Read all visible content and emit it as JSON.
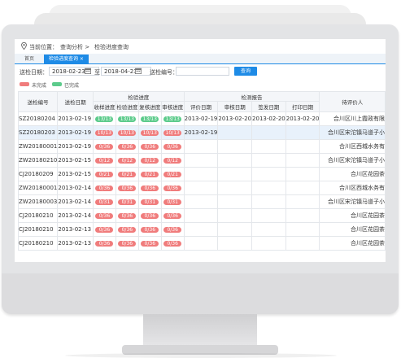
{
  "breadcrumb": {
    "location_label": "当前位置：",
    "path1": "查询分析 >",
    "path2": "检验进度查询"
  },
  "tabs": [
    {
      "label": "首页"
    },
    {
      "label": "检验进度查询 ×"
    }
  ],
  "filters": {
    "date_label": "送检日期：",
    "from_date": "2018-02-23",
    "to_label": "至",
    "to_date": "2018-04-23",
    "number_label": "送检编号：",
    "number_value": "",
    "query_button": "查询"
  },
  "legend": {
    "incomplete": {
      "label": "未完成",
      "color": "#f07c7c"
    },
    "complete": {
      "label": "已完成",
      "color": "#5ccb8b"
    }
  },
  "table": {
    "headers": {
      "code": "送检编号",
      "date": "送检日期",
      "progress_group": "检验进度",
      "report_group": "检测报告",
      "receive": "收样进度",
      "inspect": "检验进度",
      "recheck": "复核进度",
      "review": "审核进度",
      "eval_date": "评价日期",
      "audit_date": "审核日期",
      "sign_date": "签发日期",
      "print_date": "打印日期",
      "unit": "待评价人"
    },
    "rows": [
      {
        "code": "SZ20180204",
        "date": "2013-02-19",
        "p": [
          {
            "t": "13/13",
            "s": "green"
          },
          {
            "t": "13/13",
            "s": "green"
          },
          {
            "t": "13/13",
            "s": "green"
          },
          {
            "t": "13/13",
            "s": "green"
          }
        ],
        "eval": "2013-02-19",
        "audit": "2013-02-20",
        "sign": "2013-02-20",
        "print": "2013-02-20",
        "unit": "合川区川上霞政有限",
        "selected": false
      },
      {
        "code": "SZ20180203",
        "date": "2013-02-19",
        "p": [
          {
            "t": "10/13",
            "s": "red"
          },
          {
            "t": "10/13",
            "s": "red"
          },
          {
            "t": "10/13",
            "s": "red"
          },
          {
            "t": "10/13",
            "s": "red"
          }
        ],
        "eval": "2013-02-19",
        "audit": "",
        "sign": "",
        "print": "",
        "unit": "合川区宋沱镇马道子小",
        "selected": true
      },
      {
        "code": "ZW20180001",
        "date": "2013-02-19",
        "p": [
          {
            "t": "0/36",
            "s": "red"
          },
          {
            "t": "0/36",
            "s": "red"
          },
          {
            "t": "0/36",
            "s": "red"
          },
          {
            "t": "0/36",
            "s": "red"
          }
        ],
        "eval": "",
        "audit": "",
        "sign": "",
        "print": "",
        "unit": "合川区西城水务有",
        "selected": false
      },
      {
        "code": "ZW20180210",
        "date": "2013-02-15",
        "p": [
          {
            "t": "0/12",
            "s": "red"
          },
          {
            "t": "0/12",
            "s": "red"
          },
          {
            "t": "0/12",
            "s": "red"
          },
          {
            "t": "0/12",
            "s": "red"
          }
        ],
        "eval": "",
        "audit": "",
        "sign": "",
        "print": "",
        "unit": "合川区宋沱镇马道子小",
        "selected": false
      },
      {
        "code": "CJ20180209",
        "date": "2013-02-15",
        "p": [
          {
            "t": "0/21",
            "s": "red"
          },
          {
            "t": "0/21",
            "s": "red"
          },
          {
            "t": "0/21",
            "s": "red"
          },
          {
            "t": "0/21",
            "s": "red"
          }
        ],
        "eval": "",
        "audit": "",
        "sign": "",
        "print": "",
        "unit": "合川区花园茶",
        "selected": false
      },
      {
        "code": "ZW20180001",
        "date": "2013-02-14",
        "p": [
          {
            "t": "0/36",
            "s": "red"
          },
          {
            "t": "0/36",
            "s": "red"
          },
          {
            "t": "0/36",
            "s": "red"
          },
          {
            "t": "0/36",
            "s": "red"
          }
        ],
        "eval": "",
        "audit": "",
        "sign": "",
        "print": "",
        "unit": "合川区西城水务有",
        "selected": false
      },
      {
        "code": "ZW20180003",
        "date": "2013-02-14",
        "p": [
          {
            "t": "0/31",
            "s": "red"
          },
          {
            "t": "0/31",
            "s": "red"
          },
          {
            "t": "0/31",
            "s": "red"
          },
          {
            "t": "0/31",
            "s": "red"
          }
        ],
        "eval": "",
        "audit": "",
        "sign": "",
        "print": "",
        "unit": "合川区宋沱镇马道子小",
        "selected": false
      },
      {
        "code": "CJ20180210",
        "date": "2013-02-14",
        "p": [
          {
            "t": "0/36",
            "s": "red"
          },
          {
            "t": "0/36",
            "s": "red"
          },
          {
            "t": "0/36",
            "s": "red"
          },
          {
            "t": "0/36",
            "s": "red"
          }
        ],
        "eval": "",
        "audit": "",
        "sign": "",
        "print": "",
        "unit": "合川区花园茶",
        "selected": false
      },
      {
        "code": "CJ20180210",
        "date": "2013-02-13",
        "p": [
          {
            "t": "0/36",
            "s": "red"
          },
          {
            "t": "0/36",
            "s": "red"
          },
          {
            "t": "0/36",
            "s": "red"
          },
          {
            "t": "0/36",
            "s": "red"
          }
        ],
        "eval": "",
        "audit": "",
        "sign": "",
        "print": "",
        "unit": "合川区花园茶",
        "selected": false
      },
      {
        "code": "CJ20180210",
        "date": "2013-02-13",
        "p": [
          {
            "t": "0/36",
            "s": "red"
          },
          {
            "t": "0/36",
            "s": "red"
          },
          {
            "t": "0/36",
            "s": "red"
          },
          {
            "t": "0/36",
            "s": "red"
          }
        ],
        "eval": "",
        "audit": "",
        "sign": "",
        "print": "",
        "unit": "合川区花园茶",
        "selected": false
      }
    ]
  }
}
